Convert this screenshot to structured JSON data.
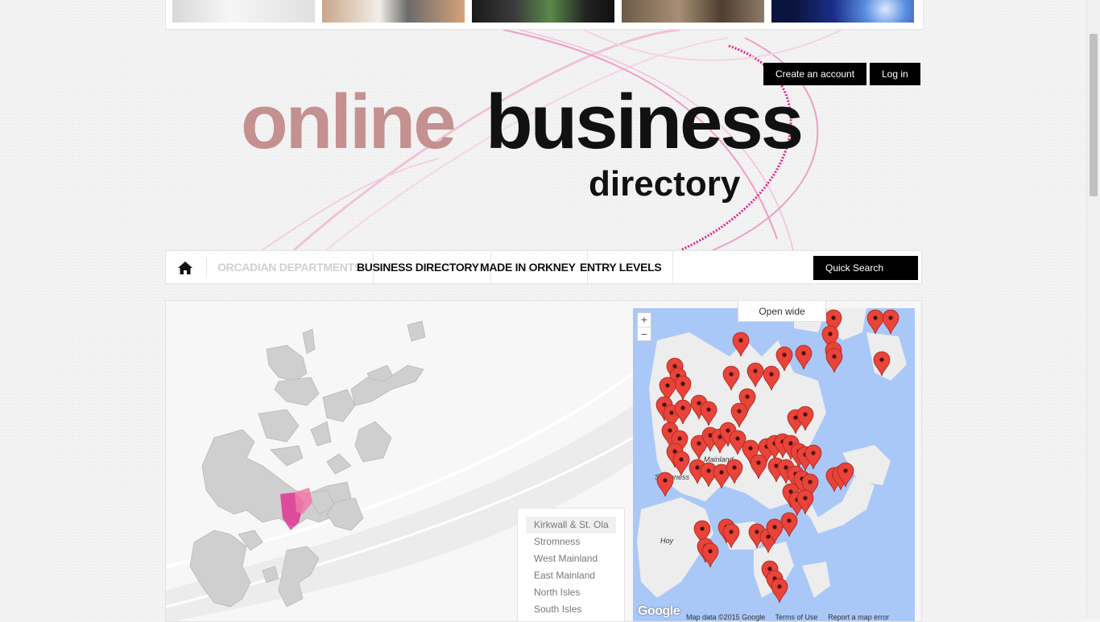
{
  "auth": {
    "create_account": "Create an account",
    "login": "Log in"
  },
  "logo": {
    "online": "online",
    "business": "business",
    "directory": "directory"
  },
  "nav": {
    "home_icon": "home-icon",
    "items": [
      {
        "label": "Orcadian Departments",
        "disabled": true
      },
      {
        "label": "Business Directory"
      },
      {
        "label": "Made in Orkney"
      },
      {
        "label": "Entry Levels"
      }
    ],
    "quick_search": "Quick Search"
  },
  "map": {
    "open_wide": "Open wide",
    "regions": [
      {
        "label": "Kirkwall & St. Ola",
        "active": true
      },
      {
        "label": "Stromness"
      },
      {
        "label": "West Mainland"
      },
      {
        "label": "East Mainland"
      },
      {
        "label": "North Isles"
      },
      {
        "label": "South Isles"
      }
    ],
    "zoom_in": "+",
    "zoom_out": "−",
    "labels": {
      "mainland": "Mainland",
      "stromness": "Stromness",
      "hoy": "Hoy"
    },
    "google": "Google",
    "footer": {
      "map_data": "Map data ©2015 Google",
      "terms": "Terms of Use",
      "report": "Report a map error"
    },
    "marker_color": "#e8443a",
    "water_color": "#a9c8f7",
    "land_color": "#ededed"
  },
  "colors": {
    "brand_pink": "#c59090",
    "accent_pink": "#e0208c",
    "button_black": "#000000"
  }
}
